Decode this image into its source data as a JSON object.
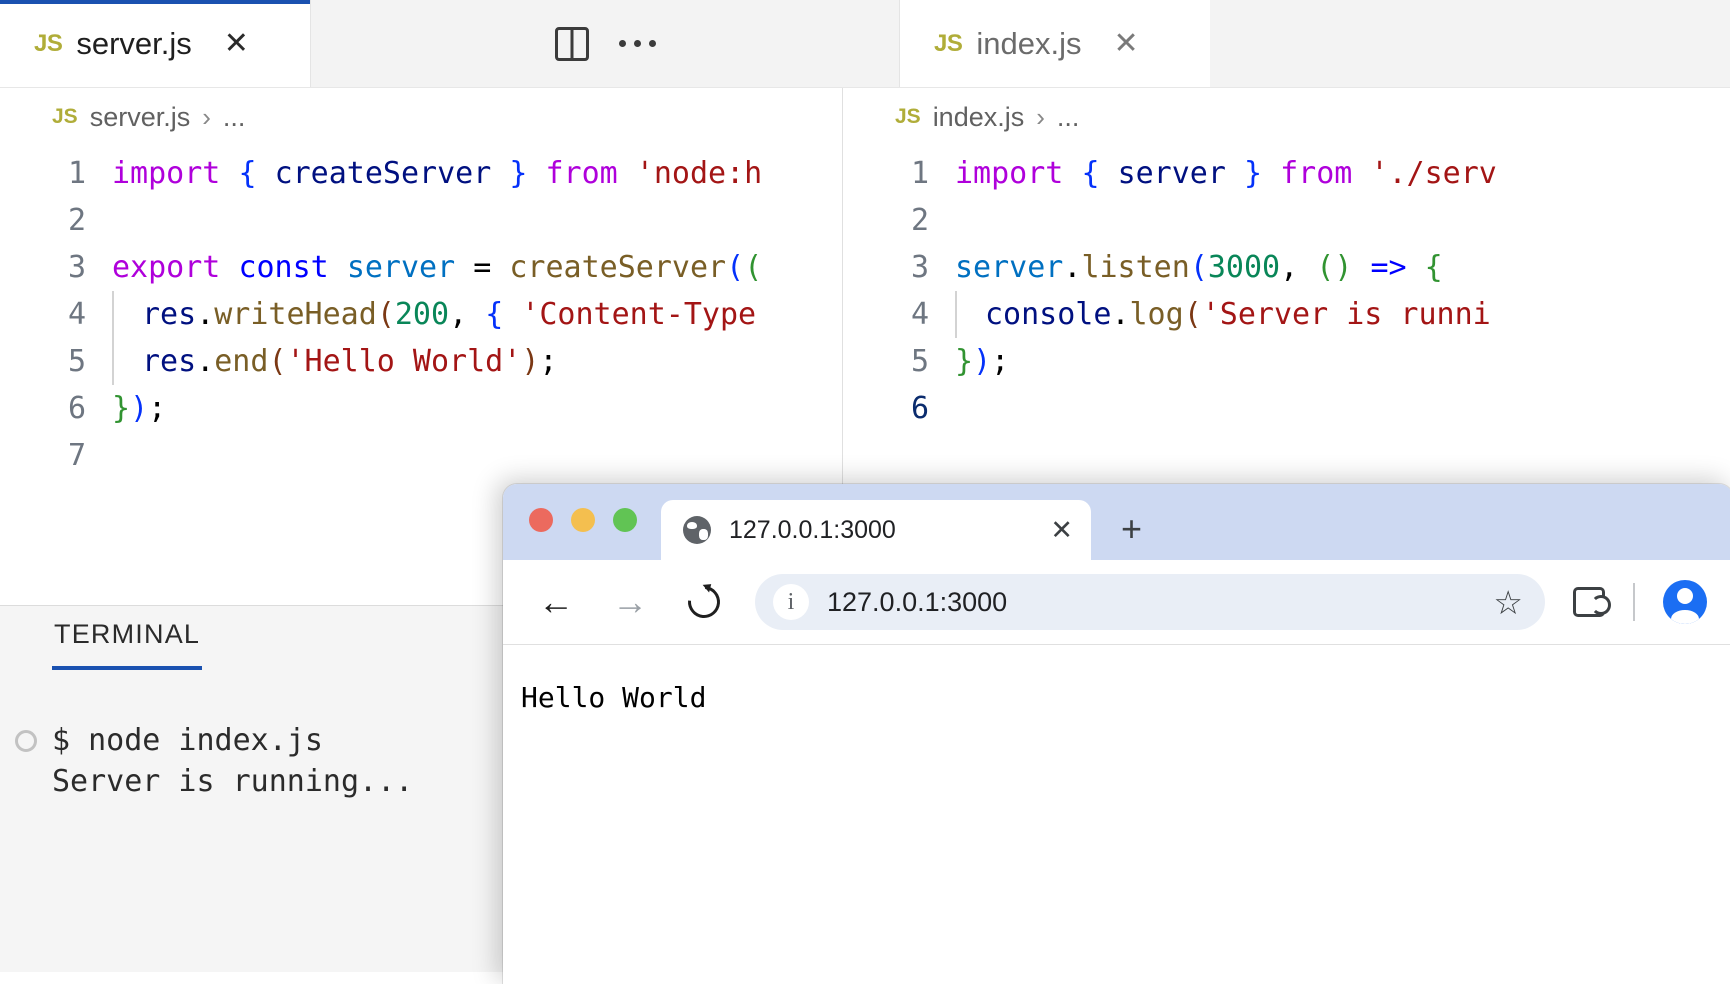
{
  "editor": {
    "tabs": [
      {
        "icon": "js-file-icon",
        "label": "server.js",
        "close": "✕",
        "active": true,
        "focused": true
      },
      {
        "icon": "js-file-icon",
        "label": "index.js",
        "close": "✕",
        "active": true,
        "focused": false
      }
    ],
    "tab_actions": {
      "split_editor": "split-editor-icon",
      "more_actions": "ellipsis-icon"
    },
    "groups": [
      {
        "breadcrumb": {
          "icon": "JS",
          "file": "server.js",
          "separator": "›",
          "rest": "..."
        },
        "lines": [
          {
            "no": "1",
            "indent": 0,
            "current": false,
            "tokens": [
              {
                "t": "import",
                "c": "t-kw"
              },
              {
                "t": " ",
                "c": "t-plain"
              },
              {
                "t": "{",
                "c": "t-br1"
              },
              {
                "t": " ",
                "c": "t-plain"
              },
              {
                "t": "createServer",
                "c": "t-var"
              },
              {
                "t": " ",
                "c": "t-plain"
              },
              {
                "t": "}",
                "c": "t-br1"
              },
              {
                "t": " ",
                "c": "t-plain"
              },
              {
                "t": "from",
                "c": "t-kw"
              },
              {
                "t": " ",
                "c": "t-plain"
              },
              {
                "t": "'node:h",
                "c": "t-str"
              }
            ]
          },
          {
            "no": "2",
            "indent": 0,
            "current": false,
            "tokens": []
          },
          {
            "no": "3",
            "indent": 0,
            "current": false,
            "tokens": [
              {
                "t": "export",
                "c": "t-kw"
              },
              {
                "t": " ",
                "c": "t-plain"
              },
              {
                "t": "const",
                "c": "t-kw2"
              },
              {
                "t": " ",
                "c": "t-plain"
              },
              {
                "t": "server",
                "c": "t-prop"
              },
              {
                "t": " ",
                "c": "t-plain"
              },
              {
                "t": "=",
                "c": "t-op"
              },
              {
                "t": " ",
                "c": "t-plain"
              },
              {
                "t": "createServer",
                "c": "t-fn"
              },
              {
                "t": "(",
                "c": "t-br1"
              },
              {
                "t": "(",
                "c": "t-br2"
              }
            ]
          },
          {
            "no": "4",
            "indent": 1,
            "current": false,
            "tokens": [
              {
                "t": "res",
                "c": "t-var"
              },
              {
                "t": ".",
                "c": "t-op"
              },
              {
                "t": "writeHead",
                "c": "t-fn"
              },
              {
                "t": "(",
                "c": "t-br3"
              },
              {
                "t": "200",
                "c": "t-num"
              },
              {
                "t": ",",
                "c": "t-op"
              },
              {
                "t": " ",
                "c": "t-plain"
              },
              {
                "t": "{",
                "c": "t-br1"
              },
              {
                "t": " ",
                "c": "t-plain"
              },
              {
                "t": "'Content-Type",
                "c": "t-str"
              }
            ]
          },
          {
            "no": "5",
            "indent": 1,
            "current": false,
            "tokens": [
              {
                "t": "res",
                "c": "t-var"
              },
              {
                "t": ".",
                "c": "t-op"
              },
              {
                "t": "end",
                "c": "t-fn"
              },
              {
                "t": "(",
                "c": "t-br3"
              },
              {
                "t": "'Hello World'",
                "c": "t-str"
              },
              {
                "t": ")",
                "c": "t-br3"
              },
              {
                "t": ";",
                "c": "t-op"
              }
            ]
          },
          {
            "no": "6",
            "indent": 0,
            "current": false,
            "tokens": [
              {
                "t": "}",
                "c": "t-br2"
              },
              {
                "t": ")",
                "c": "t-br1"
              },
              {
                "t": ";",
                "c": "t-op"
              }
            ]
          },
          {
            "no": "7",
            "indent": 0,
            "current": false,
            "tokens": []
          }
        ]
      },
      {
        "breadcrumb": {
          "icon": "JS",
          "file": "index.js",
          "separator": "›",
          "rest": "..."
        },
        "lines": [
          {
            "no": "1",
            "indent": 0,
            "current": false,
            "tokens": [
              {
                "t": "import",
                "c": "t-kw"
              },
              {
                "t": " ",
                "c": "t-plain"
              },
              {
                "t": "{",
                "c": "t-br1"
              },
              {
                "t": " ",
                "c": "t-plain"
              },
              {
                "t": "server",
                "c": "t-var"
              },
              {
                "t": " ",
                "c": "t-plain"
              },
              {
                "t": "}",
                "c": "t-br1"
              },
              {
                "t": " ",
                "c": "t-plain"
              },
              {
                "t": "from",
                "c": "t-kw"
              },
              {
                "t": " ",
                "c": "t-plain"
              },
              {
                "t": "'./serv",
                "c": "t-str"
              }
            ]
          },
          {
            "no": "2",
            "indent": 0,
            "current": false,
            "tokens": []
          },
          {
            "no": "3",
            "indent": 0,
            "current": false,
            "tokens": [
              {
                "t": "server",
                "c": "t-prop"
              },
              {
                "t": ".",
                "c": "t-op"
              },
              {
                "t": "listen",
                "c": "t-fn"
              },
              {
                "t": "(",
                "c": "t-br1"
              },
              {
                "t": "3000",
                "c": "t-num"
              },
              {
                "t": ",",
                "c": "t-op"
              },
              {
                "t": " ",
                "c": "t-plain"
              },
              {
                "t": "(",
                "c": "t-br2"
              },
              {
                "t": ")",
                "c": "t-br2"
              },
              {
                "t": " ",
                "c": "t-plain"
              },
              {
                "t": "=>",
                "c": "t-kw2"
              },
              {
                "t": " ",
                "c": "t-plain"
              },
              {
                "t": "{",
                "c": "t-br2"
              }
            ]
          },
          {
            "no": "4",
            "indent": 1,
            "current": false,
            "tokens": [
              {
                "t": "console",
                "c": "t-var"
              },
              {
                "t": ".",
                "c": "t-op"
              },
              {
                "t": "log",
                "c": "t-fn"
              },
              {
                "t": "(",
                "c": "t-br3"
              },
              {
                "t": "'Server is runni",
                "c": "t-str"
              }
            ]
          },
          {
            "no": "5",
            "indent": 0,
            "current": false,
            "tokens": [
              {
                "t": "}",
                "c": "t-br2"
              },
              {
                "t": ")",
                "c": "t-br1"
              },
              {
                "t": ";",
                "c": "t-op"
              }
            ]
          },
          {
            "no": "6",
            "indent": 0,
            "current": true,
            "tokens": []
          }
        ]
      }
    ]
  },
  "panel": {
    "tabs": [
      {
        "label": "TERMINAL",
        "active": true
      }
    ],
    "terminal": {
      "lines": [
        {
          "marker": true,
          "text": "$ node index.js"
        },
        {
          "marker": false,
          "text": "Server is running..."
        }
      ]
    }
  },
  "browser": {
    "traffic_lights": [
      "close-button",
      "minimize-button",
      "maximize-button"
    ],
    "tab": {
      "favicon": "globe-favicon",
      "title": "127.0.0.1:3000",
      "close": "✕"
    },
    "new_tab": "+",
    "toolbar": {
      "back": "←",
      "forward": "→",
      "reload": "reload-icon",
      "site_info": "ⓘ",
      "url": "127.0.0.1:3000",
      "bookmark": "☆",
      "extensions": "extensions-icon",
      "profile": "profile-avatar"
    },
    "page": {
      "body_text": "Hello World"
    }
  },
  "colors": {
    "vscode_accent": "#1a51b0",
    "js_icon": "#b0ad39",
    "browser_titlebar": "#cdd9f2",
    "omnibox": "#e9eef6",
    "avatar": "#1b6ef3"
  }
}
